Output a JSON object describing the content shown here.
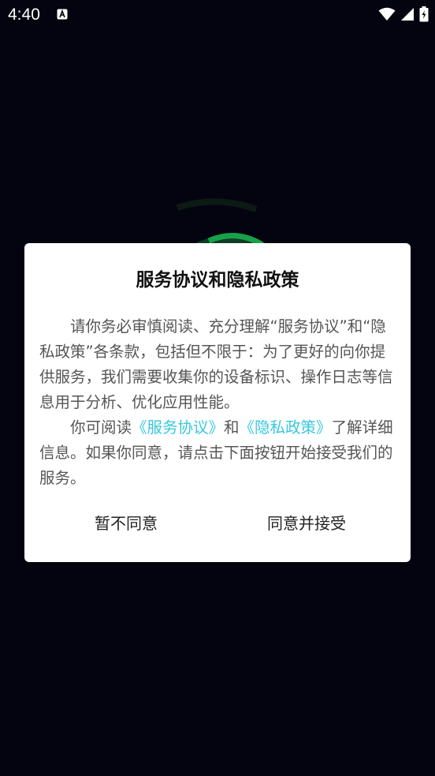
{
  "status_bar": {
    "time": "4:40"
  },
  "dialog": {
    "title": "服务协议和隐私政策",
    "para1": "请你务必审慎阅读、充分理解“服务协议”和“隐私政策”各条款，包括但不限于：为了更好的向你提供服务，我们需要收集你的设备标识、操作日志等信息用于分析、优化应用性能。",
    "para2_prefix": "你可阅读",
    "service_link": "《服务协议》",
    "para2_and": "和",
    "privacy_link": "《隐私政策》",
    "para2_suffix": "了解详细信息。如果你同意，请点击下面按钮开始接受我们的服务。",
    "decline_label": "暂不同意",
    "accept_label": "同意并接受"
  },
  "colors": {
    "background": "#040410",
    "link": "#37c7de",
    "dialog_bg": "#ffffff"
  }
}
